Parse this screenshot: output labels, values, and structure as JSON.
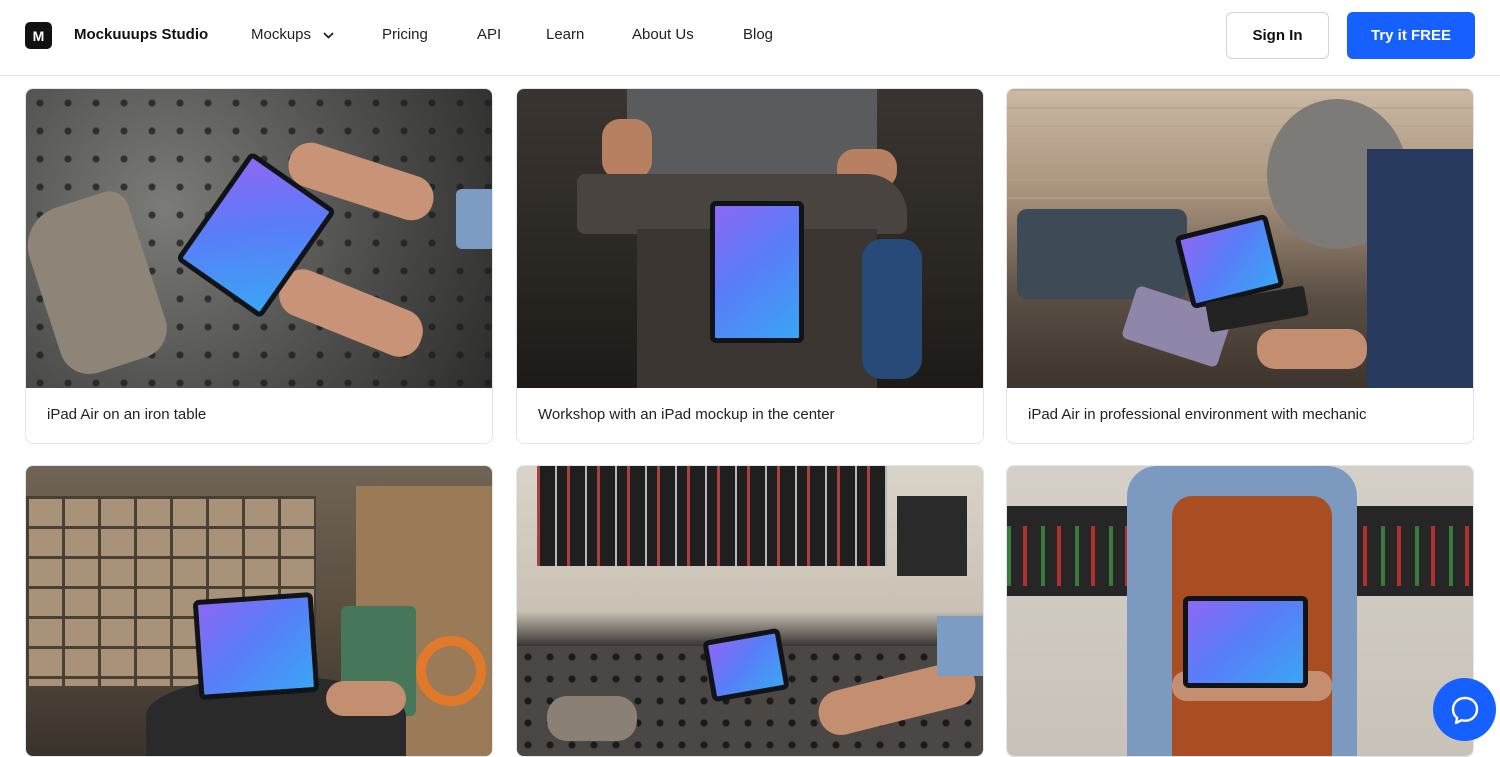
{
  "header": {
    "logo_mark": "M",
    "brand": "Mockuuups Studio",
    "nav": [
      "Mockups",
      "Pricing",
      "API",
      "Learn",
      "About Us",
      "Blog"
    ],
    "sign_in": "Sign In",
    "try_free": "Try it FREE"
  },
  "cards": [
    {
      "caption": "iPad Air on an iron table"
    },
    {
      "caption": "Workshop with an iPad mockup in the center"
    },
    {
      "caption": "iPad Air in professional environment with mechanic"
    },
    {
      "caption": ""
    },
    {
      "caption": ""
    },
    {
      "caption": ""
    }
  ],
  "colors": {
    "accent": "#1560ff",
    "screen_gradient_start": "#8d68f5",
    "screen_gradient_end": "#3aa5f5"
  }
}
